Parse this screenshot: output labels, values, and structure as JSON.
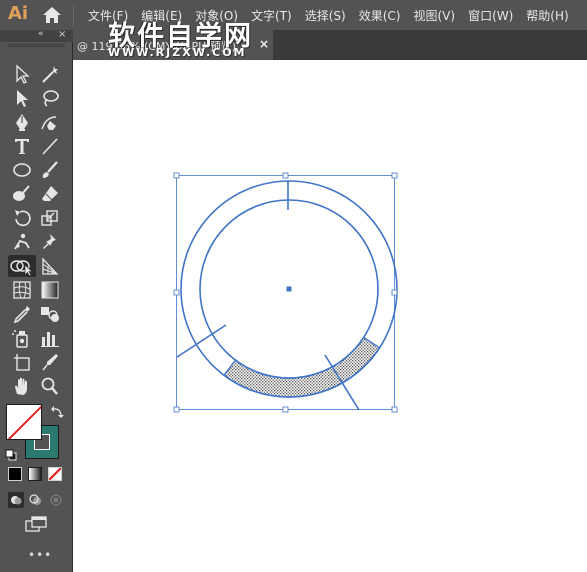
{
  "app": {
    "logo": "Ai"
  },
  "menu": {
    "items": [
      "文件(F)",
      "编辑(E)",
      "对象(O)",
      "文字(T)",
      "选择(S)",
      "效果(C)",
      "视图(V)",
      "窗口(W)",
      "帮助(H)"
    ]
  },
  "document_tab": {
    "label": "@ 119.06% (CMYK/GPU 预览)",
    "close_label": "×"
  },
  "watermark": {
    "title": "软件自学网",
    "url": "WWW.RJZXW.COM"
  },
  "tools_panel": {
    "collapse_label": "«",
    "close_label": "×",
    "tools": [
      "selection-tool",
      "magic-wand-tool",
      "direct-selection-tool",
      "lasso-tool",
      "pen-tool",
      "curvature-tool",
      "type-tool",
      "line-segment-tool",
      "ellipse-tool",
      "paintbrush-tool",
      "blob-brush-tool",
      "eraser-tool",
      "rotate-tool",
      "scale-tool",
      "puppet-warp-tool",
      "pin-tool",
      "shape-builder-tool",
      "perspective-grid-tool",
      "mesh-tool",
      "gradient-tool",
      "eyedropper-tool",
      "blend-tool",
      "symbol-sprayer-tool",
      "column-graph-tool",
      "artboard-tool",
      "slice-tool",
      "hand-tool",
      "zoom-tool"
    ],
    "active_tool": "shape-builder-tool",
    "more_label": "•••"
  },
  "colors": {
    "ui_dark": "#535353",
    "stroke_color": "#2b7a6f",
    "selection_blue": "#3f74c8",
    "none_red": "#e02020"
  }
}
